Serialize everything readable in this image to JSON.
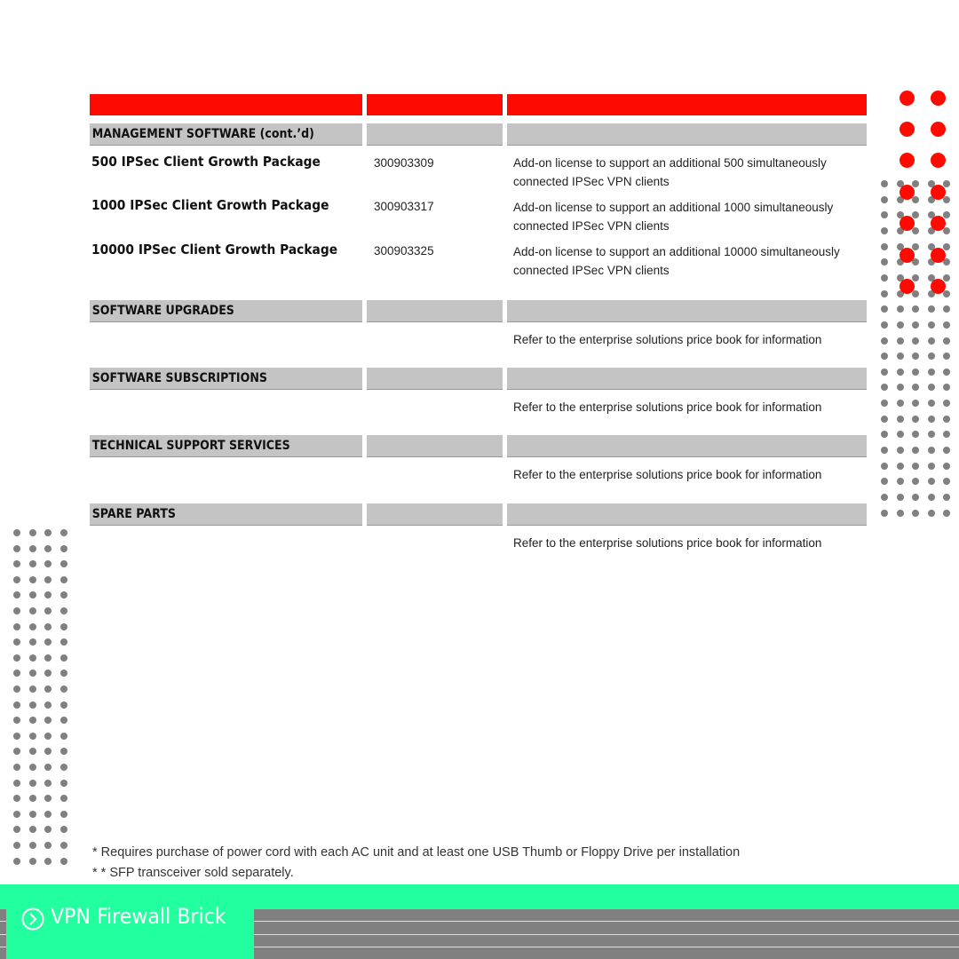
{
  "sections": [
    {
      "title": "MANAGEMENT SOFTWARE (cont.’d)"
    },
    {
      "title": "SOFTWARE UPGRADES",
      "note": "Refer to the enterprise solutions price book for information"
    },
    {
      "title": "SOFTWARE SUBSCRIPTIONS",
      "note": "Refer to the enterprise solutions price book for information"
    },
    {
      "title": "TECHNICAL SUPPORT SERVICES",
      "note": "Refer to the enterprise solutions price book for information"
    },
    {
      "title": "SPARE PARTS",
      "note": "Refer to the enterprise solutions price book for information"
    }
  ],
  "products": [
    {
      "name": "500 IPSec Client Growth Package",
      "part": "300903309",
      "desc1": "Add-on license to support an additional 500 simultaneously",
      "desc2": "connected IPSec VPN clients"
    },
    {
      "name": "1000 IPSec Client Growth Package",
      "part": "300903317",
      "desc1": "Add-on license to support an additional 1000 simultaneously",
      "desc2": "connected IPSec VPN clients"
    },
    {
      "name": "10000 IPSec Client Growth Package",
      "part": "300903325",
      "desc1": "Add-on license to support an additional 10000 simultaneously",
      "desc2": "connected IPSec VPN clients"
    }
  ],
  "footnotes": [
    "*  Requires purchase of power cord with each AC unit and at least one USB Thumb or Floppy Drive per installation",
    "* *  SFP transceiver sold separately."
  ],
  "footer": {
    "title": "VPN Firewall Brick",
    "icon": "chevron-circle-icon"
  },
  "colors": {
    "accent": "#ff0a00",
    "footer": "#21ff9f",
    "section": "#c4c4c4",
    "dots": "#808080"
  }
}
